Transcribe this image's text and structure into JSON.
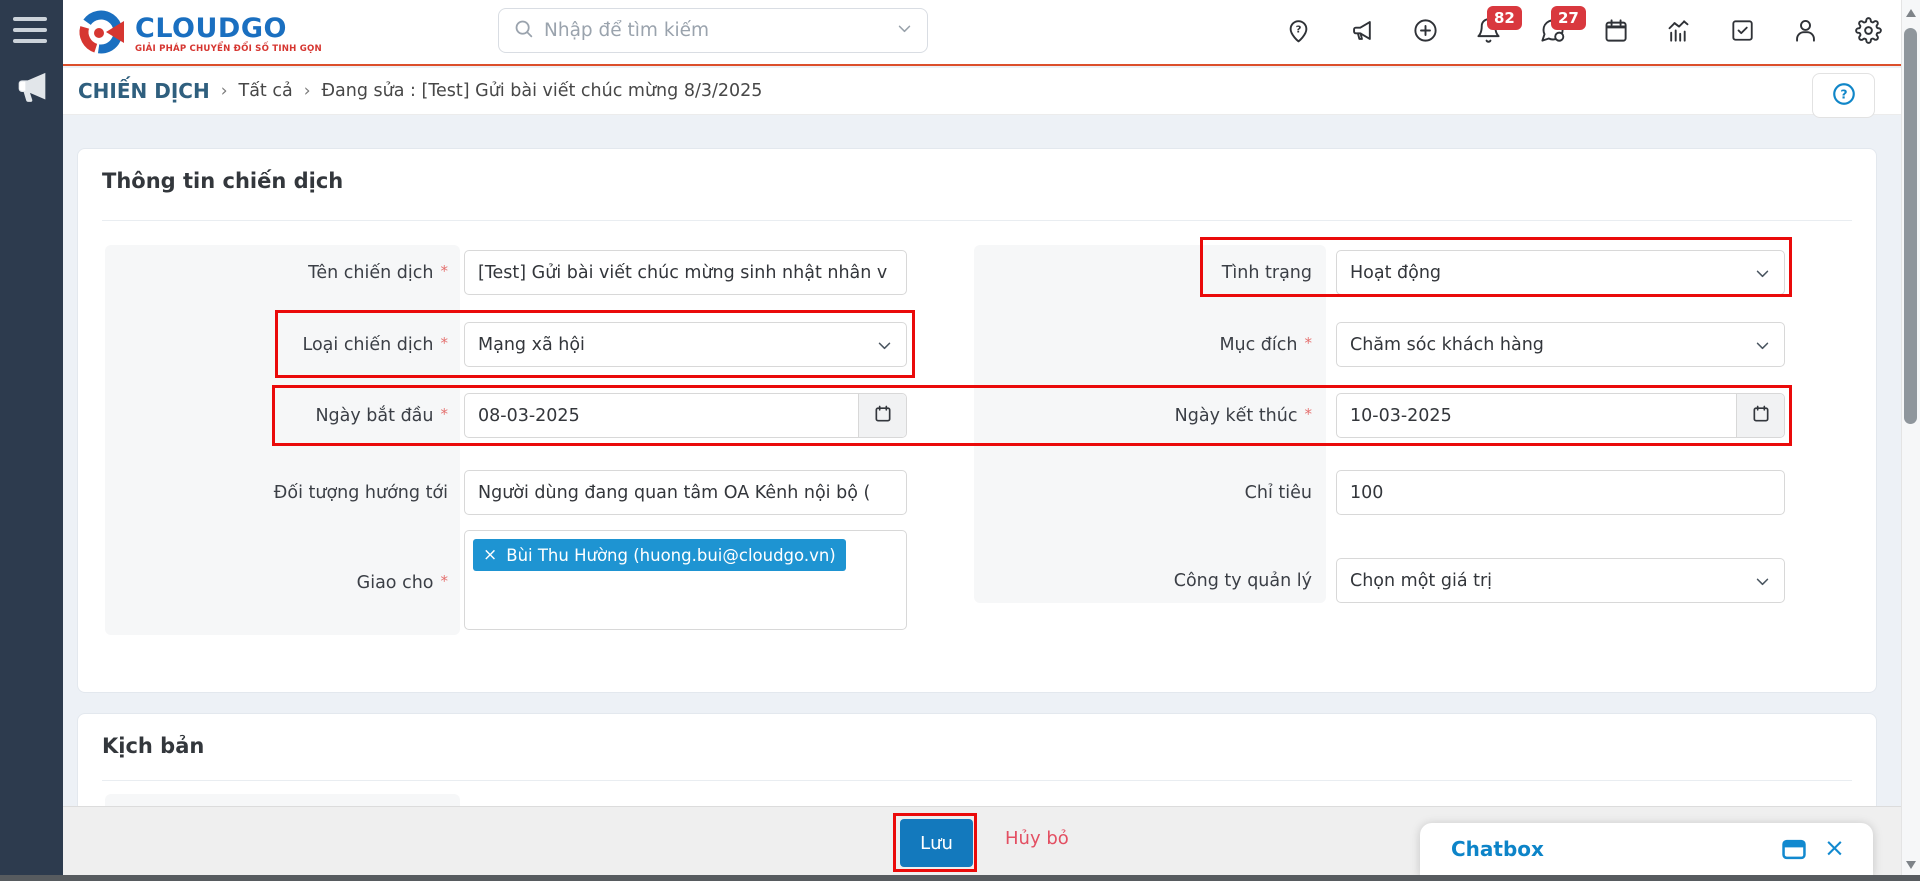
{
  "brand": {
    "name": "CLOUDGO",
    "tagline": "GIẢI PHÁP CHUYỂN ĐỔI SỐ TINH GỌN"
  },
  "header": {
    "search_placeholder": "Nhập để tìm kiếm",
    "notification_count": "82",
    "message_count": "27",
    "icons": [
      "location-pin",
      "megaphone",
      "plus-circle",
      "bell",
      "chat",
      "calendar",
      "stats",
      "tasks",
      "user",
      "gear"
    ]
  },
  "breadcrumb": {
    "root": "CHIẾN DỊCH",
    "separator": "›",
    "section": "Tất cả",
    "current": "Đang sửa : [Test] Gửi bài viết chúc mừng 8/3/2025"
  },
  "form": {
    "title": "Thông tin chiến dịch",
    "fields": {
      "ten_chien_dich": {
        "label": "Tên chiến dịch",
        "required": "*",
        "value": "[Test] Gửi bài viết chúc mừng sinh nhật nhân v"
      },
      "tinh_trang": {
        "label": "Tình trạng",
        "value": "Hoạt động"
      },
      "loai_chien_dich": {
        "label": "Loại chiến dịch",
        "required": "*",
        "value": "Mạng xã hội"
      },
      "muc_dich": {
        "label": "Mục đích",
        "required": "*",
        "value": "Chăm sóc khách hàng"
      },
      "ngay_bat_dau": {
        "label": "Ngày bắt đầu",
        "required": "*",
        "value": "08-03-2025"
      },
      "ngay_ket_thuc": {
        "label": "Ngày kết thúc",
        "required": "*",
        "value": "10-03-2025"
      },
      "doi_tuong": {
        "label": "Đối tượng hướng tới",
        "value": "Người dùng đang quan tâm OA Kênh nội bộ ("
      },
      "chi_tieu": {
        "label": "Chỉ tiêu",
        "value": "100"
      },
      "giao_cho": {
        "label": "Giao cho",
        "required": "*",
        "tag_remove": "×",
        "tag": "Bùi Thu Hường (huong.bui@cloudgo.vn)"
      },
      "cong_ty": {
        "label": "Công ty quản lý",
        "value": "Chọn một giá trị"
      }
    }
  },
  "script_section": {
    "title": "Kịch bản"
  },
  "footer": {
    "save": "Lưu",
    "cancel": "Hủy bỏ"
  },
  "chatbox": {
    "title": "Chatbox",
    "close": "×"
  },
  "colors": {
    "sidebar_navy": "#2d3b4e",
    "header_border_red": "#dc4f2b",
    "brand_blue": "#1a6fc0",
    "brand_red": "#d63631",
    "badge_red": "#d9383e",
    "annotation_red": "#ea0a0a",
    "tag_blue": "#1e94d2",
    "save_blue": "#1379bd",
    "cancel_red": "#e34f62",
    "chat_blue": "#0d84c8"
  }
}
